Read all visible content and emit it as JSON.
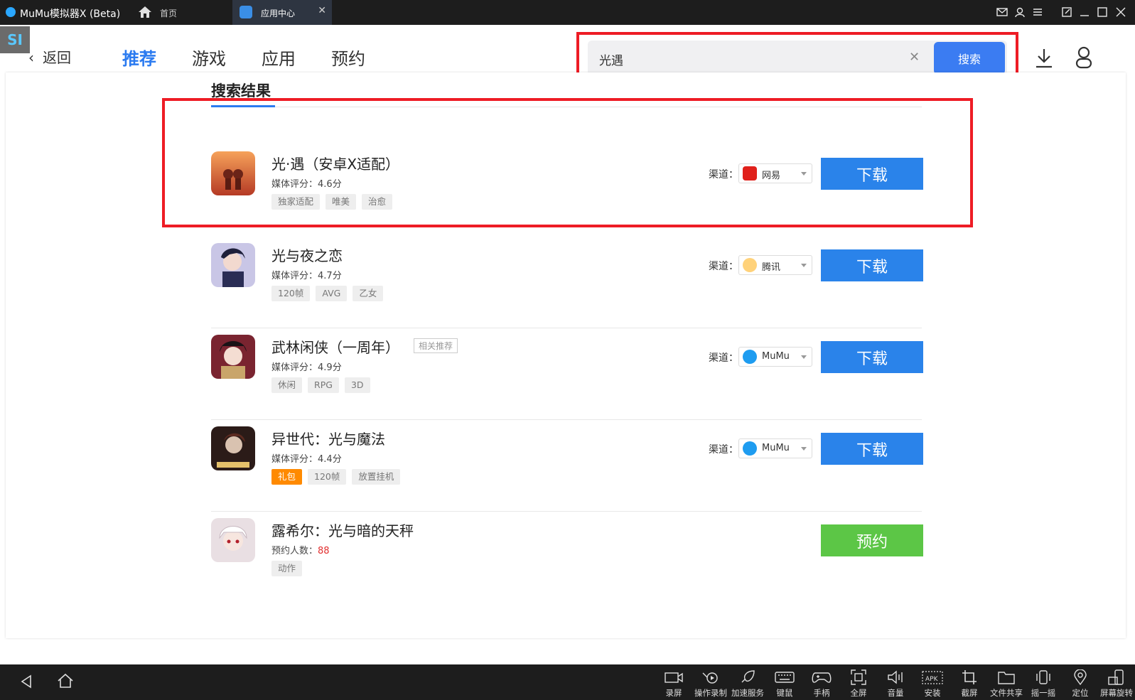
{
  "titlebar": {
    "app_name": "MuMu模拟器X (Beta)",
    "home_label": "首页",
    "active_tab": "应用中心"
  },
  "nav": {
    "back_label": "返回",
    "tabs": [
      "推荐",
      "游戏",
      "应用",
      "预约"
    ],
    "active_tab": "推荐"
  },
  "search": {
    "query": "光遇",
    "button_label": "搜索"
  },
  "results": {
    "title": "搜索结果",
    "channel_label": "渠道：",
    "items": [
      {
        "name": "光·遇（安卓X适配）",
        "meta_prefix": "媒体评分：",
        "meta_value": "4.6分",
        "tags": [
          "独家适配",
          "唯美",
          "治愈"
        ],
        "channel": "网易",
        "action": "下载",
        "highlighted": true
      },
      {
        "name": "光与夜之恋",
        "meta_prefix": "媒体评分：",
        "meta_value": "4.7分",
        "tags": [
          "120帧",
          "AVG",
          "乙女"
        ],
        "channel": "腾讯",
        "action": "下载"
      },
      {
        "name": "武林闲侠（一周年）",
        "related": "相关推荐",
        "meta_prefix": "媒体评分：",
        "meta_value": "4.9分",
        "tags": [
          "休闲",
          "RPG",
          "3D"
        ],
        "channel": "MuMu",
        "action": "下载"
      },
      {
        "name": "异世代：光与魔法",
        "meta_prefix": "媒体评分：",
        "meta_value": "4.4分",
        "tags": [
          "礼包",
          "120帧",
          "放置挂机"
        ],
        "channel": "MuMu",
        "action": "下载"
      },
      {
        "name": "露希尔：光与暗的天秤",
        "meta_prefix": "预约人数：",
        "meta_value": "88",
        "tags": [
          "动作"
        ],
        "action": "预约"
      }
    ]
  },
  "toolbar": {
    "tools": [
      "录屏",
      "操作录制",
      "加速服务",
      "键鼠",
      "手柄",
      "全屏",
      "音量",
      "安装",
      "截屏",
      "文件共享",
      "摇一摇",
      "定位",
      "屏幕旋转"
    ]
  },
  "colors": {
    "accent": "#2b7bf0",
    "download": "#2a83ea",
    "reserve": "#5cc646",
    "highlight": "#ee1c25"
  }
}
